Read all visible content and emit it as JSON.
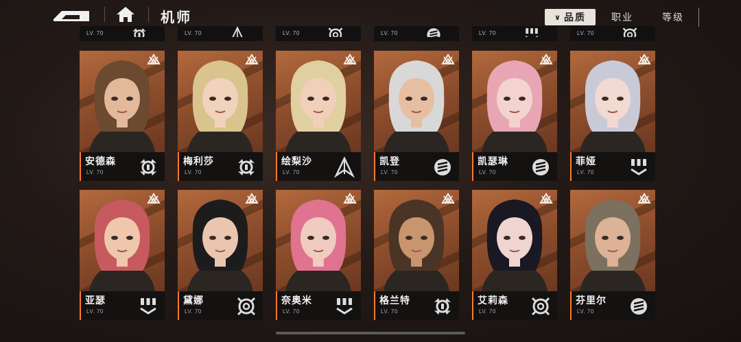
{
  "header": {
    "title": "机师",
    "sort_tabs": [
      {
        "label": "品质",
        "active": true
      },
      {
        "label": "职业",
        "active": false
      },
      {
        "label": "等级",
        "active": false
      }
    ]
  },
  "partial_row": [
    {
      "level": "LV. 70",
      "role_icon": "gear-role-icon"
    },
    {
      "level": "LV. 70",
      "role_icon": "arrow-role-icon"
    },
    {
      "level": "LV. 70",
      "role_icon": "target-role-icon"
    },
    {
      "level": "LV. 70",
      "role_icon": "shield-role-icon"
    },
    {
      "level": "LV. 70",
      "role_icon": "drone-role-icon"
    },
    {
      "level": "LV. 70",
      "role_icon": "target-role-icon"
    }
  ],
  "pilots": [
    {
      "name": "安德森",
      "level": "LV. 70",
      "role_icon": "gear-role-icon",
      "hair": "#6b4a30",
      "skin": "#e2b99a"
    },
    {
      "name": "梅利莎",
      "level": "LV. 70",
      "role_icon": "gear-role-icon",
      "hair": "#d9c48e",
      "skin": "#f1d2bd"
    },
    {
      "name": "绘梨沙",
      "level": "LV. 70",
      "role_icon": "arrow-role-icon",
      "hair": "#e0cfa0",
      "skin": "#f0d0b8"
    },
    {
      "name": "凯登",
      "level": "LV. 70",
      "role_icon": "shield-role-icon",
      "hair": "#d8d8d8",
      "skin": "#e6bfa3"
    },
    {
      "name": "凯瑟琳",
      "level": "LV. 70",
      "role_icon": "shield-role-icon",
      "hair": "#e8a6b4",
      "skin": "#f3d3cf"
    },
    {
      "name": "菲娅",
      "level": "LV. 70",
      "role_icon": "drone-role-icon",
      "hair": "#c9cad8",
      "skin": "#f2d9d2"
    },
    {
      "name": "亚瑟",
      "level": "LV. 70",
      "role_icon": "drone-role-icon",
      "hair": "#c65a5e",
      "skin": "#efc7ad"
    },
    {
      "name": "黛娜",
      "level": "LV. 70",
      "role_icon": "target-role-icon",
      "hair": "#1c1c1c",
      "skin": "#eac6b0"
    },
    {
      "name": "奈奥米",
      "level": "LV. 70",
      "role_icon": "drone-role-icon",
      "hair": "#e0738f",
      "skin": "#f0cbc0"
    },
    {
      "name": "格兰特",
      "level": "LV. 70",
      "role_icon": "gear-role-icon",
      "hair": "#4a3426",
      "skin": "#c8956e"
    },
    {
      "name": "艾莉森",
      "level": "LV. 70",
      "role_icon": "target-role-icon",
      "hair": "#1a1822",
      "skin": "#efd4d0"
    },
    {
      "name": "芬里尔",
      "level": "LV. 70",
      "role_icon": "shield-role-icon",
      "hair": "#7c705e",
      "skin": "#dcb396"
    }
  ],
  "colors": {
    "accent": "#ff7a2f",
    "portrait_bg": "#a65f37",
    "card_bg": "#141111"
  }
}
